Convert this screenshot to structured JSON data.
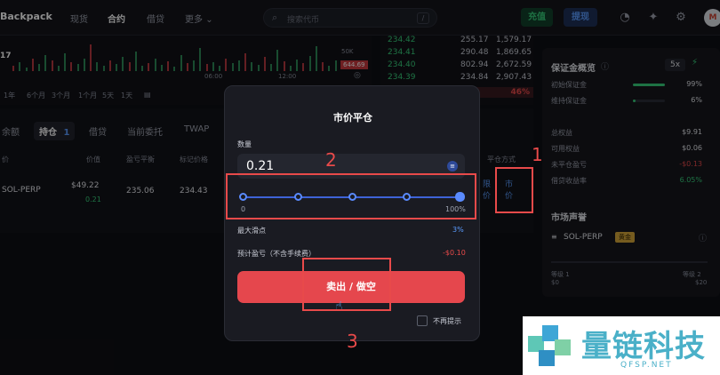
{
  "brand": "Backpack",
  "nav": [
    "现货",
    "合约",
    "借贷",
    "更多"
  ],
  "search": {
    "placeholder": "搜索代币",
    "shortcut": "/"
  },
  "top_buttons": {
    "deposit": "充值",
    "withdraw": "提现"
  },
  "avatar_letter": "M",
  "chart": {
    "tag_17": "17",
    "label_50k": "50K",
    "price_tag": "644.69",
    "timeframes": [
      "1年",
      "6个月",
      "3个月",
      "1个月",
      "5天",
      "1天"
    ],
    "times": [
      "06:00",
      "12:00"
    ]
  },
  "orderbook": {
    "rows": [
      [
        "234.42",
        "255.17",
        "1,579.17"
      ],
      [
        "234.41",
        "290.48",
        "1,869.65"
      ],
      [
        "234.40",
        "802.94",
        "2,672.59"
      ],
      [
        "234.39",
        "234.84",
        "2,907.43"
      ]
    ],
    "percent": "46%"
  },
  "positions": {
    "tabs": [
      "余额",
      "持仓",
      "借贷",
      "当前委托",
      "TWAP"
    ],
    "active_count": "1",
    "col_headers": [
      "价",
      "价值",
      "盈亏平衡",
      "标记价格"
    ],
    "row": {
      "symbol": "SOL-PERP",
      "value": "$49.22",
      "value_sub": "0.21",
      "breakeven": "235.06",
      "mark": "234.43"
    },
    "close_method_label": "平仓方式",
    "limit_label": "限价",
    "market_label": "市价"
  },
  "margin": {
    "title": "保证金概览",
    "leverage": "5x",
    "initial_label": "初始保证金",
    "initial_val": "99%",
    "maint_label": "维持保证金",
    "maint_val": "6%",
    "equity_label": "总权益",
    "equity_val": "$9.91",
    "available_label": "可用权益",
    "available_val": "$0.06",
    "unrealized_label": "未平仓盈亏",
    "unrealized_val": "-$0.13",
    "lend_label": "借贷收益率",
    "lend_val": "6.05%",
    "reputation_title": "市场声誉",
    "rep_symbol": "SOL-PERP",
    "rep_badge": "黄金",
    "level1": "等级 1",
    "level2": "等级 2",
    "lvl1_val": "$0",
    "lvl2_val": "$20"
  },
  "modal": {
    "title": "市价平仓",
    "qty_label": "数量",
    "qty_value": "0.21",
    "slider_min": "0",
    "slider_max": "100%",
    "slider_fraction": 1.0,
    "slippage_label": "最大滑点",
    "slippage_val": "3%",
    "pnl_label": "预计盈亏（不含手续费）",
    "pnl_val": "-$0.10",
    "sell_button": "卖出 / 做空",
    "dont_show": "不再提示"
  },
  "annotations": [
    "1",
    "2",
    "3"
  ],
  "watermark": {
    "text": "量链科技",
    "sub": "QFSP.NET"
  },
  "colors": {
    "red": "#e84a4a",
    "green": "#38d07c",
    "blue": "#5a9cff",
    "sell": "#e5474d"
  }
}
